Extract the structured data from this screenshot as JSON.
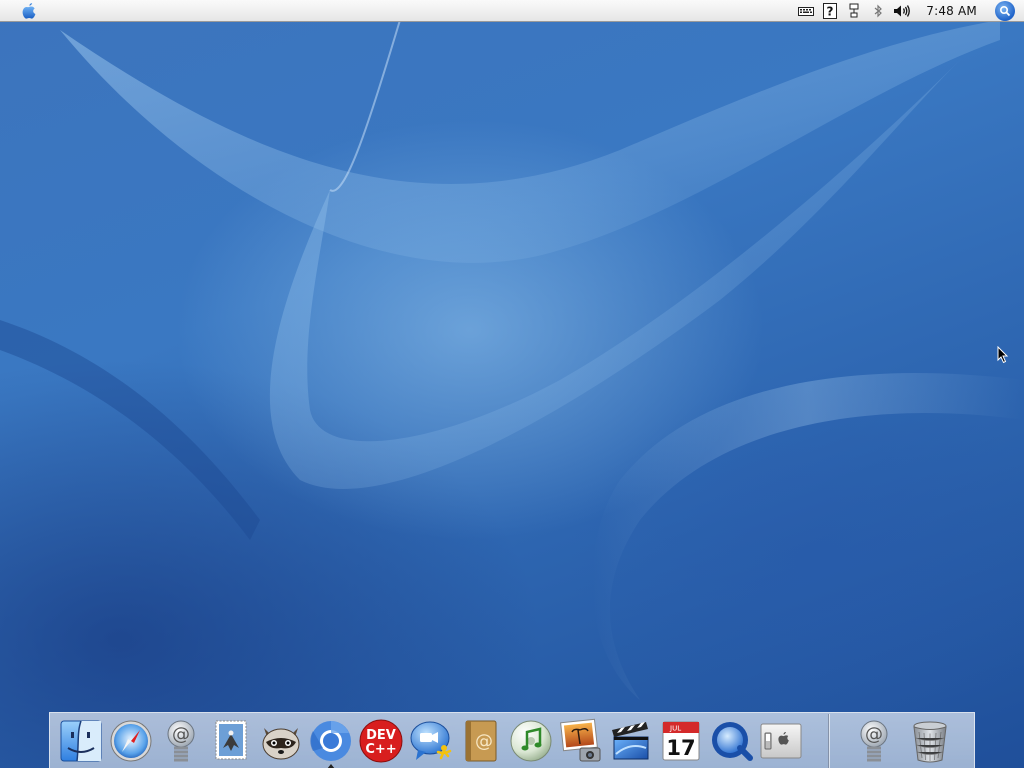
{
  "menubar": {
    "apple_menu": "apple-logo-icon",
    "status_icons": [
      "keyboard-icon",
      "help-icon",
      "network-icon",
      "bluetooth-icon",
      "volume-icon"
    ],
    "clock": "7:48 AM",
    "spotlight": "spotlight-search-icon"
  },
  "dock": {
    "apps": [
      {
        "name": "finder",
        "icon": "finder-icon"
      },
      {
        "name": "safari",
        "icon": "safari-compass-icon"
      },
      {
        "name": "mail-at",
        "icon": "at-sign-spring-icon"
      },
      {
        "name": "mail",
        "icon": "mail-stamp-eagle-icon"
      },
      {
        "name": "raccoon",
        "icon": "raccoon-icon"
      },
      {
        "name": "chromium",
        "icon": "chromium-icon",
        "running": true
      },
      {
        "name": "dev-c++",
        "icon": "devcpp-icon",
        "label": "DEV",
        "label2": "C++"
      },
      {
        "name": "ichat",
        "icon": "ichat-aim-icon"
      },
      {
        "name": "address-book",
        "icon": "address-book-icon",
        "label": "@"
      },
      {
        "name": "itunes",
        "icon": "itunes-icon"
      },
      {
        "name": "iphoto",
        "icon": "iphoto-icon"
      },
      {
        "name": "imovie",
        "icon": "imovie-clapper-icon"
      },
      {
        "name": "ical",
        "icon": "ical-calendar-icon",
        "month": "JUL",
        "day": "17"
      },
      {
        "name": "quicktime",
        "icon": "quicktime-icon"
      },
      {
        "name": "system-preferences",
        "icon": "system-switch-apple-icon"
      }
    ],
    "extras": [
      {
        "name": "mail-at-docked",
        "icon": "at-sign-spring-icon"
      },
      {
        "name": "trash",
        "icon": "trash-icon"
      }
    ]
  },
  "colors": {
    "menubar": "#eeeeee",
    "wallpaper_primary": "#3a78c2",
    "wallpaper_dark": "#1f4f9a",
    "spotlight": "#1f63c9",
    "devcpp_red": "#d81e1e"
  }
}
